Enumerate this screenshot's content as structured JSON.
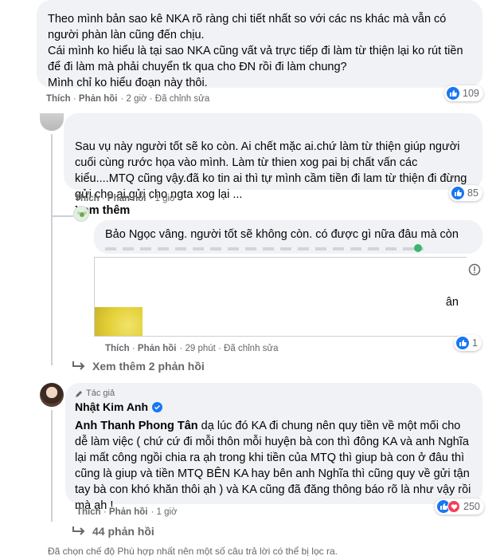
{
  "comment1": {
    "text": "Theo mình bản sao kê NKA rõ ràng chi tiết nhất so với các ns khác mà vẫn có người phàn làn cũng đến chịu.\nCái mình ko hiểu là tại sao NKA cũng vất vả trực tiếp đi làm từ thiện lại ko rút tiền để đi làm mà phải chuyển tk qua cho ĐN rồi đi làm chung?\nMình chỉ ko hiểu đoạn này thôi.",
    "like_label": "Thích",
    "reply_label": "Phản hồi",
    "meta": "· 2 giờ · Đã chỉnh sửa",
    "reactions": "109"
  },
  "comment2": {
    "text": "Sau vụ này người tốt sẽ ko còn. Ai chết mặc ai.chứ làm từ thiện giúp người cuối cùng rước họa vào mình. Làm từ thien xog pai bị chất vấn các kiểu....MTQ cũng vậy.đã ko tin ai thì tự mình cầm tiền đi lam từ thiện đi đừng gửi cho ai.gửi cho ngta xog lại ...",
    "see_more": "Xem thêm",
    "like_label": "Thích",
    "reply_label": "Phản hồi",
    "meta": "· 1 giờ",
    "reactions": "85"
  },
  "reply1": {
    "text": "Bảo Ngọc vâng. người tốt sẽ không còn. có được gì nữa đâu mà còn",
    "preview_text": "ân",
    "like_label": "Thích",
    "reply_label": "Phản hồi",
    "meta": "· 29 phút · Đã chỉnh sửa",
    "reactions": "1"
  },
  "more_replies_1": "Xem thêm 2 phản hồi",
  "author_comment": {
    "badge": "Tác giả",
    "name": "Nhật Kim Anh",
    "mention": "Anh Thanh Phong Tân",
    "text": " dạ lúc đó KA đi chung nên quy tiền về một mối cho dễ làm việc ( chứ cứ đi mỗi thôn mỗi huyện bà con thì đông KA và anh Nghĩa lại mất công ngồi chia ra ạh trong khi tiền của MTQ thì giup bà con ở đâu thì cũng là giup và tiền MTQ BÊN KA hay bên anh Nghĩa thì cũng quy về gửi tận tay bà con khó khăn thôi ạh ) và KA cũng đã đăng thông báo rõ là như vậy rồi mà ạh !",
    "like_label": "Thích",
    "reply_label": "Phản hồi",
    "meta": "· 1 giờ",
    "reactions": "250"
  },
  "more_replies_2": "44 phản hồi",
  "footer_note": "Đã chọn chế độ Phù hợp nhất nên một số câu trả lời có thể bị lọc ra.",
  "colors": {
    "like": "#1877f2",
    "heart": "#f33e58",
    "bubble": "#f0f2f5",
    "meta": "#65676b",
    "verified": "#1877f2"
  }
}
